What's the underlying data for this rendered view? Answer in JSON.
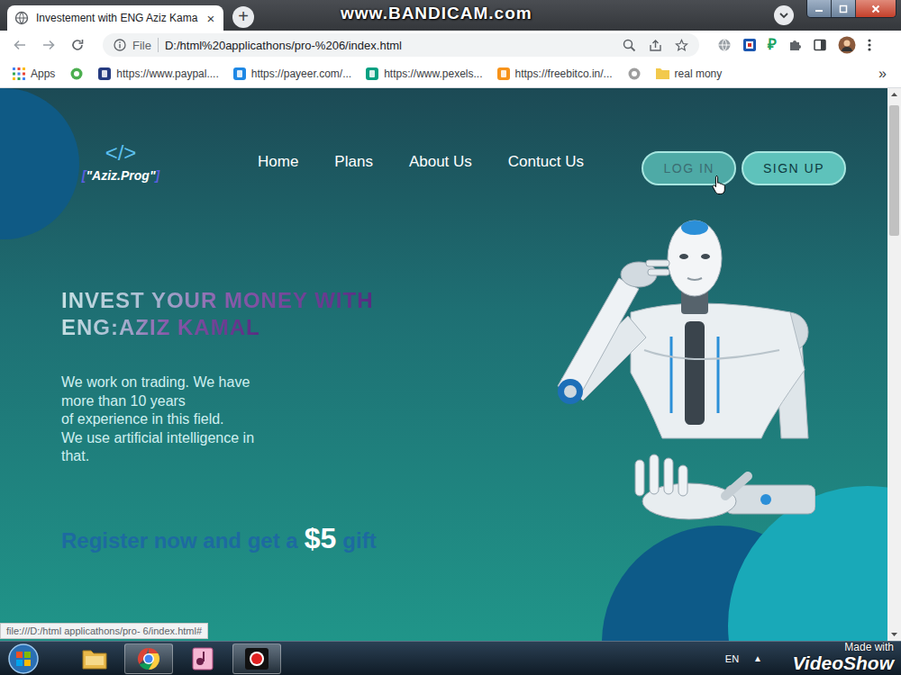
{
  "browser": {
    "watermark": "www.BANDICAM.com",
    "tab": {
      "title": "Investement with ENG Aziz Kama",
      "close": "×",
      "selected": true
    },
    "new_tab": "+",
    "address": {
      "scheme": "File",
      "url": "D:/html%20applicathons/pro-%206/index.html"
    },
    "extension_glyph": "₽",
    "bookmarks": [
      {
        "kind": "apps",
        "label": "Apps"
      },
      {
        "kind": "icon",
        "color": "#4caf50"
      },
      {
        "kind": "link",
        "label": "https://www.paypal....",
        "color": "#253b80"
      },
      {
        "kind": "link",
        "label": "https://payeer.com/...",
        "color": "#1e88e5"
      },
      {
        "kind": "link",
        "label": "https://www.pexels...",
        "color": "#05a081"
      },
      {
        "kind": "link",
        "label": "https://freebitco.in/...",
        "color": "#f7931a"
      },
      {
        "kind": "icon",
        "color": "#9e9e9e"
      },
      {
        "kind": "folder",
        "label": "real mony",
        "color": "#f2c94c"
      }
    ],
    "more": "»",
    "status": "file:///D:/html applicathons/pro- 6/index.html#"
  },
  "page": {
    "logo": {
      "mark": "</>",
      "open": "[",
      "name": "\"Aziz.Prog\"",
      "close": "]"
    },
    "nav": [
      "Home",
      "Plans",
      "About Us",
      "Contuct Us"
    ],
    "auth": [
      {
        "label": "LOG IN",
        "hovered": true
      },
      {
        "label": "SIGN UP",
        "hovered": false
      }
    ],
    "heading": [
      "INVEST YOUR MONEY WITH",
      "ENG:AZIZ KAMAL"
    ],
    "paragraph": [
      "We work on trading. We have",
      "more than 10 years",
      "of experience in this field.",
      "We use artificial intelligence in",
      "that."
    ],
    "register": {
      "before": "Register now and get a",
      "amount": "$5",
      "after": "gift"
    }
  },
  "taskbar": {
    "apps": [
      {
        "kind": "explorer",
        "active": false
      },
      {
        "kind": "chrome",
        "active": true
      },
      {
        "kind": "media",
        "active": false
      },
      {
        "kind": "recorder",
        "active": true
      }
    ],
    "language": "EN",
    "tray_arrow": "▲",
    "watermark": {
      "line1": "Made with",
      "line2": "VideoShow"
    }
  }
}
